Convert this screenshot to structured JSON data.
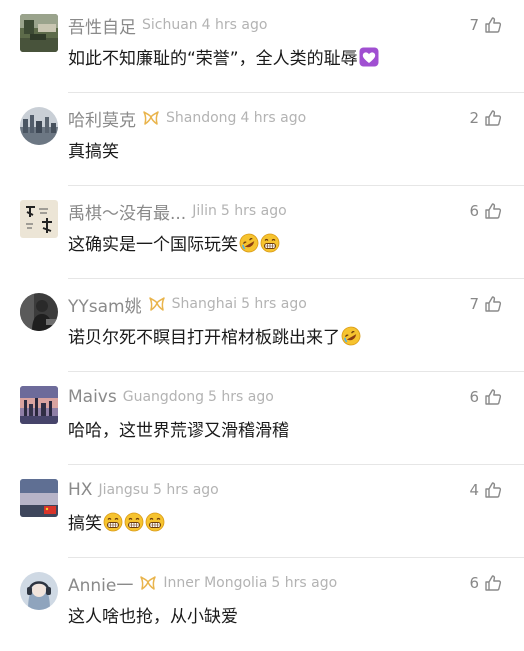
{
  "colors": {
    "username": "#8a8a8a",
    "meta": "#b3b3b3",
    "text": "#1a1a1a",
    "badge": "#e9b44c",
    "divider": "#e6e6e6"
  },
  "comments": [
    {
      "username": "吾性自足",
      "location": "Sichuan",
      "time": "4 hrs ago",
      "text": "如此不知廉耻的“荣誉”，全人类的耻辱",
      "emojis": [
        "purple-heart"
      ],
      "likes": "7",
      "badge": false,
      "avatar": "landscape-photo"
    },
    {
      "username": "哈利莫克",
      "location": "Shandong",
      "time": "4 hrs ago",
      "text": "真搞笑",
      "emojis": [],
      "likes": "2",
      "badge": true,
      "avatar": "city-skyline-photo"
    },
    {
      "username": "禹棋～没有最...",
      "location": "Jilin",
      "time": "5 hrs ago",
      "text": "这确实是一个国际玩笑",
      "emojis": [
        "rolling-laugh",
        "grin"
      ],
      "likes": "6",
      "badge": false,
      "avatar": "calligraphy-image"
    },
    {
      "username": "YYsam姚",
      "location": "Shanghai",
      "time": "5 hrs ago",
      "text": "诺贝尔死不瞑目打开棺材板跳出来了",
      "emojis": [
        "rolling-laugh"
      ],
      "likes": "7",
      "badge": true,
      "avatar": "person-photo"
    },
    {
      "username": "Maivs",
      "location": "Guangdong",
      "time": "5 hrs ago",
      "text": "哈哈，这世界荒谬又滑稽滑稽",
      "emojis": [],
      "likes": "6",
      "badge": false,
      "avatar": "sunset-city-photo"
    },
    {
      "username": "HX",
      "location": "Jiangsu",
      "time": "5 hrs ago",
      "text": "搞笑",
      "emojis": [
        "grin",
        "grin",
        "grin"
      ],
      "likes": "4",
      "badge": false,
      "avatar": "sky-flag-photo"
    },
    {
      "username": "Annie一",
      "location": "Inner Mongolia",
      "time": "5 hrs ago",
      "text": "这人啥也抢，从小缺爱",
      "emojis": [],
      "likes": "6",
      "badge": true,
      "avatar": "anime-headphones-avatar"
    }
  ]
}
